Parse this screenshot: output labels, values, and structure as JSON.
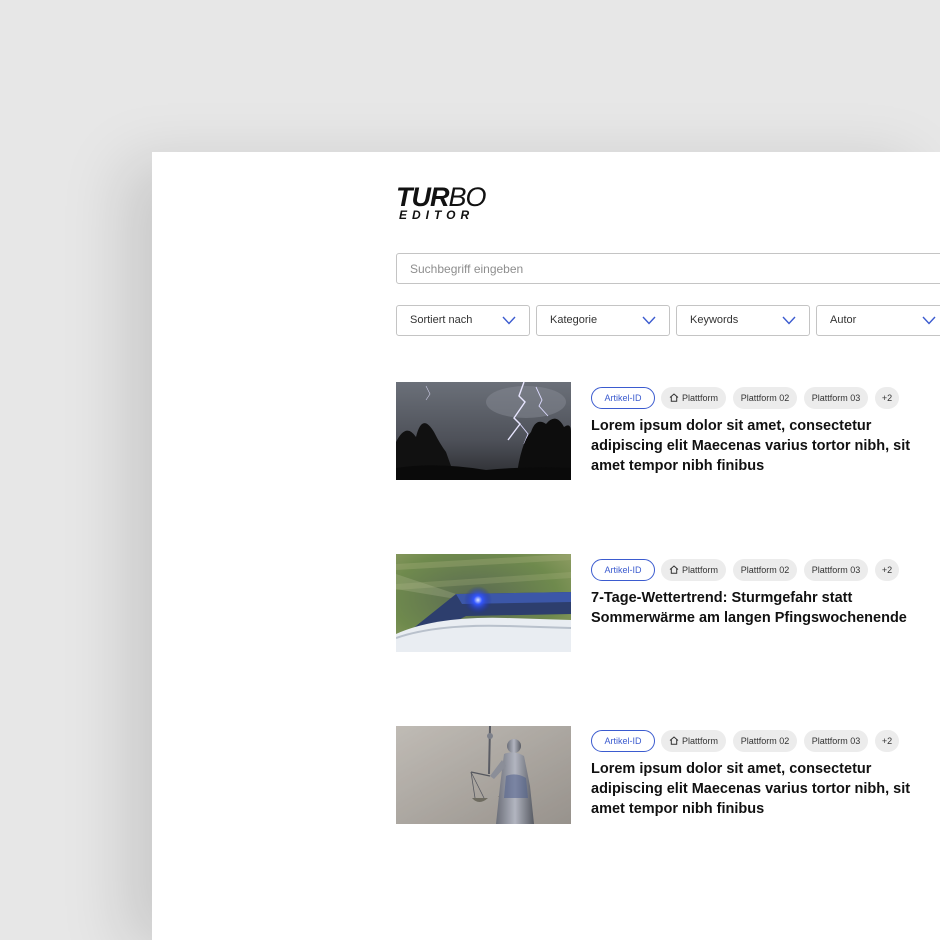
{
  "logo": {
    "line1_bold": "TUR",
    "line1_light": "BO",
    "line2": "EDITOR"
  },
  "search": {
    "placeholder": "Suchbegriff eingeben",
    "value": ""
  },
  "filters": [
    {
      "label": "Sortiert nach",
      "icon": "chevron-down-icon"
    },
    {
      "label": "Kategorie",
      "icon": "chevron-down-icon"
    },
    {
      "label": "Keywords",
      "icon": "chevron-down-icon"
    },
    {
      "label": "Autor",
      "icon": "chevron-down-icon"
    }
  ],
  "articles": [
    {
      "image": "lightning-storm-photo",
      "tags": [
        "Artikel-ID",
        "Plattform",
        "Plattform 02",
        "Plattform 03",
        "+2"
      ],
      "title": "Lorem ipsum dolor sit amet, consectetur adipiscing elit Maecenas varius tortor nibh, sit amet tempor nibh finibus"
    },
    {
      "image": "police-car-photo",
      "tags": [
        "Artikel-ID",
        "Plattform",
        "Plattform 02",
        "Plattform 03",
        "+2"
      ],
      "title": "7-Tage-Wettertrend: Sturmgefahr statt Sommerwärme am langen Pfingswochenende"
    },
    {
      "image": "lady-justice-statue-photo",
      "tags": [
        "Artikel-ID",
        "Plattform",
        "Plattform 02",
        "Plattform 03",
        "+2"
      ],
      "title": "Lorem ipsum dolor sit amet, consectetur adipiscing elit Maecenas varius tortor nibh, sit amet tempor nibh finibus"
    }
  ],
  "colors": {
    "accent": "#3b5bcf",
    "chip_bg": "#ececec",
    "page_bg": "#e7e7e7",
    "panel_bg": "#ffffff"
  }
}
